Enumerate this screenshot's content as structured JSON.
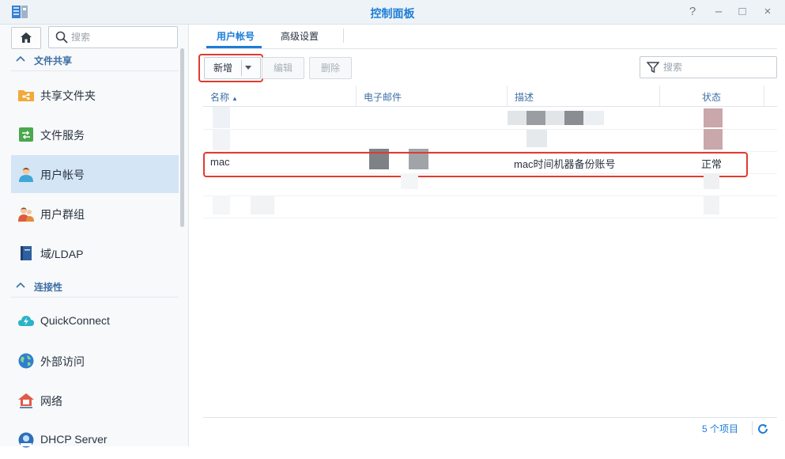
{
  "window": {
    "title": "控制面板",
    "buttons": {
      "help": "?",
      "minimize": "–",
      "maximize": "□",
      "close": "×"
    }
  },
  "sidebar": {
    "search_placeholder": "搜索",
    "sections": [
      {
        "label": "文件共享",
        "items": [
          {
            "label": "共享文件夹",
            "icon": "shared-folder-icon"
          },
          {
            "label": "文件服务",
            "icon": "file-services-icon"
          },
          {
            "label": "用户帐号",
            "icon": "user-icon",
            "active": true
          },
          {
            "label": "用户群组",
            "icon": "user-group-icon"
          },
          {
            "label": "域/LDAP",
            "icon": "domain-ldap-icon"
          }
        ]
      },
      {
        "label": "连接性",
        "items": [
          {
            "label": "QuickConnect",
            "icon": "cloud-icon"
          },
          {
            "label": "外部访问",
            "icon": "globe-icon"
          },
          {
            "label": "网络",
            "icon": "network-house-icon"
          },
          {
            "label": "DHCP Server",
            "icon": "dhcp-icon"
          }
        ]
      }
    ]
  },
  "tabs": [
    {
      "label": "用户帐号",
      "active": true
    },
    {
      "label": "高级设置",
      "active": false
    }
  ],
  "toolbar": {
    "new_label": "新增",
    "edit_label": "编辑",
    "delete_label": "删除",
    "search_placeholder": "搜索"
  },
  "table": {
    "columns": [
      "名称",
      "电子邮件",
      "描述",
      "状态"
    ],
    "rows": [
      {
        "name": "",
        "email": "",
        "description": "",
        "status": ""
      },
      {
        "name": "",
        "email": "",
        "description": "",
        "status": ""
      },
      {
        "name": "mac",
        "email": "",
        "description": "mac时间机器备份账号",
        "status": "正常",
        "highlighted": true
      },
      {
        "name": "",
        "email": "",
        "description": "",
        "status": ""
      },
      {
        "name": "",
        "email": "",
        "description": "",
        "status": ""
      }
    ]
  },
  "footer": {
    "count": "5 个项目"
  },
  "colors": {
    "accent": "#1d7dd6",
    "highlight": "#e03b2e",
    "active_bg": "#d4e5f6"
  }
}
